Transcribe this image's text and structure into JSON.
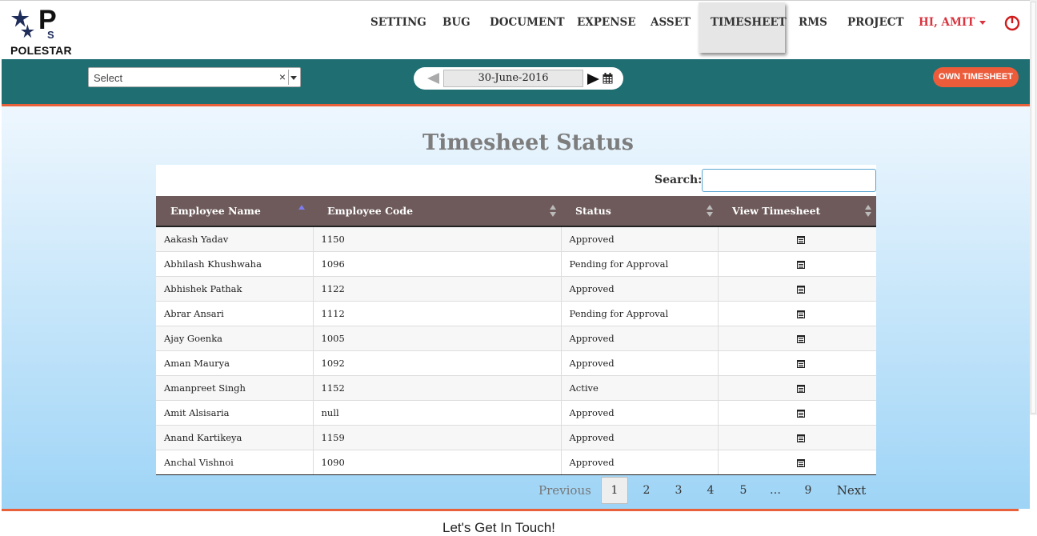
{
  "brand": {
    "name": "POLESTAR",
    "accent": "#1f6e72",
    "highlight": "#e8613a"
  },
  "nav": {
    "items": [
      {
        "label": "SETTING"
      },
      {
        "label": "BUG"
      },
      {
        "label": "DOCUMENT"
      },
      {
        "label": "EXPENSE"
      },
      {
        "label": "ASSET"
      },
      {
        "label": "TIMESHEET",
        "active": true
      },
      {
        "label": "RMS"
      },
      {
        "label": "PROJECT"
      }
    ],
    "user_label": "HI, AMIT",
    "power_icon": "power-icon"
  },
  "toolbar": {
    "select_placeholder": "Select",
    "clear_symbol": "×",
    "date": "30-June-2016",
    "own_timesheet_label": "OWN TIMESHEET"
  },
  "main": {
    "title": "Timesheet Status",
    "search_label": "Search:",
    "search_value": ""
  },
  "table": {
    "columns": [
      "Employee Name",
      "Employee Code",
      "Status",
      "View Timesheet"
    ],
    "rows": [
      {
        "name": "Aakash Yadav",
        "code": "1150",
        "status": "Approved"
      },
      {
        "name": "Abhilash Khushwaha",
        "code": "1096",
        "status": "Pending for Approval"
      },
      {
        "name": "Abhishek Pathak",
        "code": "1122",
        "status": "Approved"
      },
      {
        "name": "Abrar Ansari",
        "code": "1112",
        "status": "Pending for Approval"
      },
      {
        "name": "Ajay Goenka",
        "code": "1005",
        "status": "Approved"
      },
      {
        "name": "Aman Maurya",
        "code": "1092",
        "status": "Approved"
      },
      {
        "name": "Amanpreet Singh",
        "code": "1152",
        "status": "Active"
      },
      {
        "name": "Amit Alsisaria",
        "code": "null",
        "status": "Approved"
      },
      {
        "name": "Anand Kartikeya",
        "code": "1159",
        "status": "Approved"
      },
      {
        "name": "Anchal Vishnoi",
        "code": "1090",
        "status": "Approved"
      }
    ]
  },
  "pagination": {
    "previous": "Previous",
    "pages": [
      "1",
      "2",
      "3",
      "4",
      "5",
      "…",
      "9"
    ],
    "current": "1",
    "next": "Next"
  },
  "footer": {
    "text": "Let's Get In Touch!"
  }
}
